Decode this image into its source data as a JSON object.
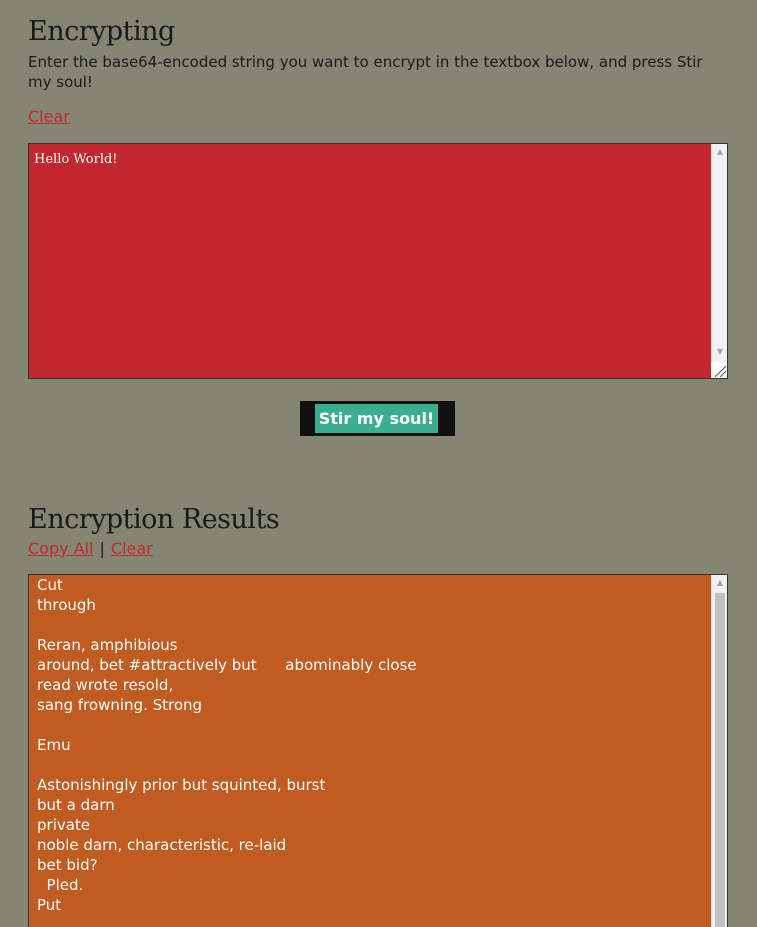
{
  "encrypt": {
    "title": "Encrypting",
    "instructions": "Enter the base64-encoded string you want to encrypt in the textbox below, and press Stir my soul!",
    "clear_label": "Clear",
    "input_value": "Hello World!",
    "submit_label": "Stir my soul!"
  },
  "results": {
    "title": "Encryption Results",
    "copy_all_label": "Copy All",
    "separator": "|",
    "clear_label": "Clear",
    "output_value": "Cut\nthrough\n\nReran, amphibious\naround, bet #attractively but      abominably close\nread wrote resold,\nsang frowning. Strong\n\nEmu\n\nAstonishingly prior but squinted, burst\nbut a darn\nprivate\nnoble darn, characteristic, re-laid\nbet bid?\n  Pled.\nPut"
  },
  "colors": {
    "background": "#858573",
    "input_bg": "#c1272d",
    "output_bg": "#c05b22",
    "button_bg": "#3aaf8f",
    "link": "#c32a2a"
  }
}
